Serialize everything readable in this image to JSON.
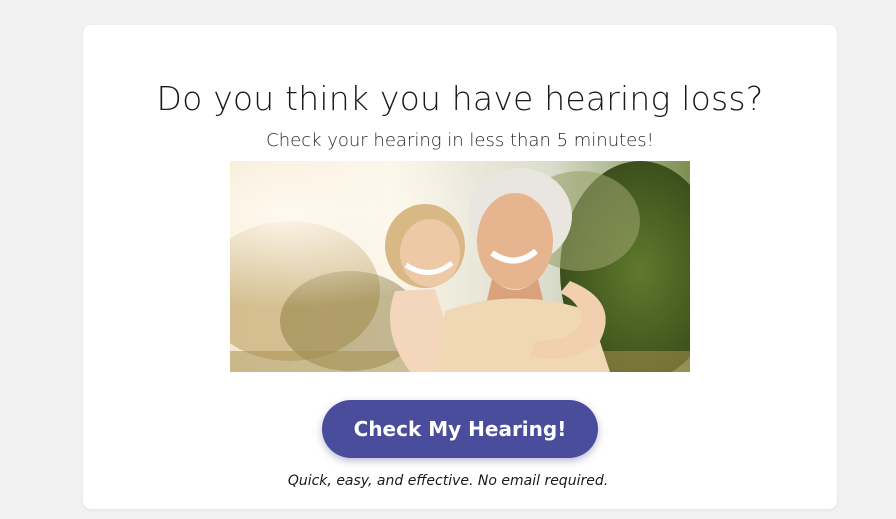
{
  "headline": "Do you think you have hearing loss?",
  "subheadline": "Check your hearing in less than 5 minutes!",
  "hero_image": {
    "description_icon": "photo-grandmother-and-granddaughter"
  },
  "cta": {
    "label": "Check My Hearing!"
  },
  "note": "Quick, easy, and effective. No email required.",
  "colors": {
    "page_bg": "#f2f2f2",
    "card_bg": "#ffffff",
    "button_bg": "#4a4d9c",
    "button_text": "#ffffff"
  }
}
